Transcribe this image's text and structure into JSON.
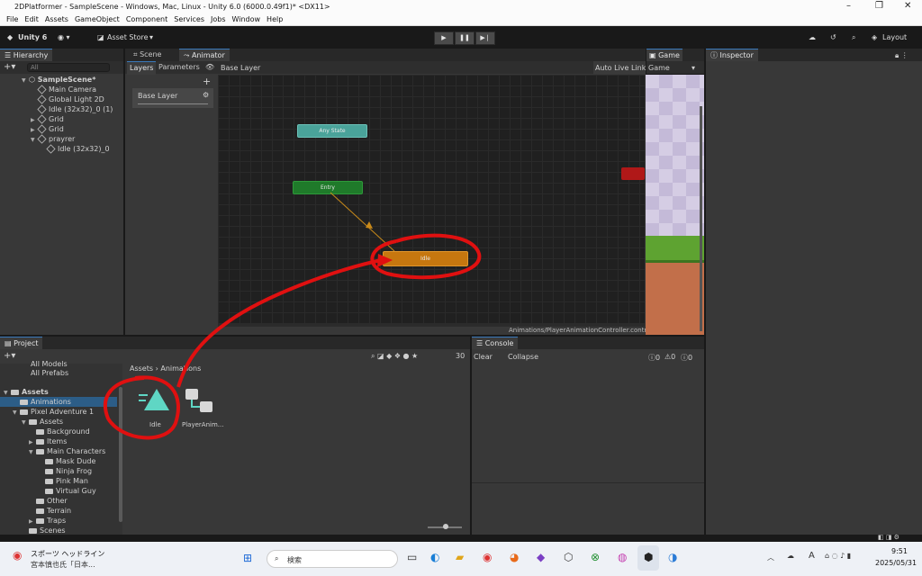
{
  "window": {
    "title": "2DPlatformer - SampleScene - Windows, Mac, Linux - Unity 6.0 (6000.0.49f1)* <DX11>"
  },
  "menu": [
    "File",
    "Edit",
    "Assets",
    "GameObject",
    "Component",
    "Services",
    "Jobs",
    "Window",
    "Help"
  ],
  "toolbar": {
    "unity_label": "Unity 6",
    "asset_store": "Asset Store",
    "layout": "Layout"
  },
  "hierarchy": {
    "tab": "Hierarchy",
    "search_placeholder": "All",
    "scene": "SampleScene*",
    "items": [
      "Main Camera",
      "Global Light 2D",
      "Idle (32x32)_0 (1)",
      "Grid",
      "Grid",
      "prayrer",
      "Idle (32x32)_0"
    ]
  },
  "tabs": {
    "scene": "Scene",
    "animator": "Animator",
    "game": "Game",
    "inspector": "Inspector",
    "project": "Project",
    "console": "Console"
  },
  "animator": {
    "layers": "Layers",
    "parameters": "Parameters",
    "breadcrumb": "Base Layer",
    "auto_live_link": "Auto Live Link",
    "base_layer": "Base Layer",
    "path": "Animations/PlayerAnimationController.controller",
    "nodes": {
      "any_state": "Any State",
      "entry": "Entry",
      "idle": "Idle"
    }
  },
  "game": {
    "display": "Game"
  },
  "project": {
    "breadcrumb_root": "Assets",
    "breadcrumb_leaf": "Animations",
    "count": "30",
    "tree": [
      "All Models",
      "All Prefabs",
      "Assets",
      "Animations",
      "Pixel Adventure 1",
      "Assets",
      "Background",
      "Items",
      "Main Characters",
      "Mask Dude",
      "Ninja Frog",
      "Pink Man",
      "Virtual Guy",
      "Other",
      "Terrain",
      "Traps",
      "Scenes"
    ],
    "assets": [
      {
        "name": "Idle"
      },
      {
        "name": "PlayerAnim..."
      }
    ]
  },
  "console": {
    "clear": "Clear",
    "collapse": "Collapse",
    "n1": "0",
    "n2": "0",
    "n3": "0"
  },
  "taskbar": {
    "news_title": "スポーツ ヘッドライン",
    "news_sub": "宮本慎也氏「日本...",
    "search": "検索",
    "time": "9:51",
    "date": "2025/05/31",
    "lang": "A"
  },
  "colors": {
    "accent": "#3a79bb",
    "idle": "#c6770f",
    "entry": "#1f7a2a",
    "any_state": "#3a8f86",
    "annotation": "#e01010"
  }
}
